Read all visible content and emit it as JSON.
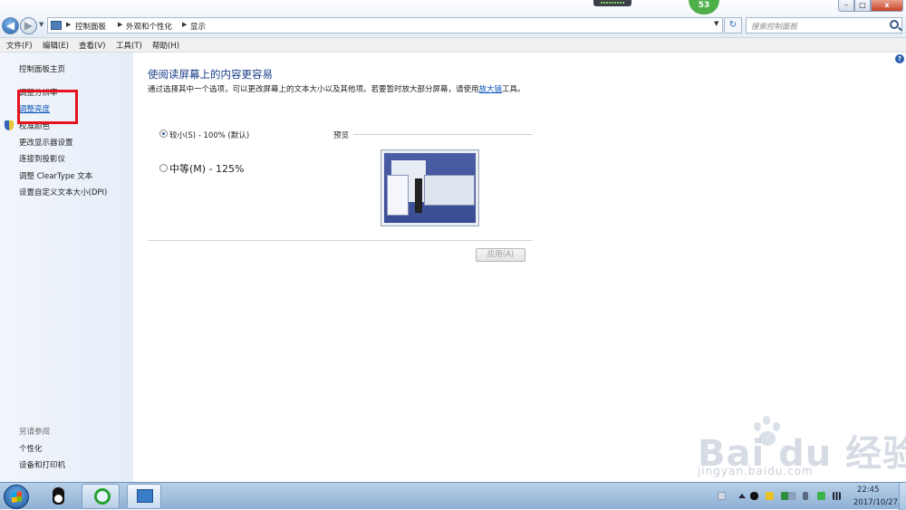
{
  "window": {
    "breadcrumb": [
      "控制面板",
      "外观和个性化",
      "显示"
    ],
    "search_placeholder": "搜索控制面板",
    "min_label": "–",
    "max_label": "□",
    "close_label": "x",
    "badge_count": "53"
  },
  "menu": [
    "文件(F)",
    "编辑(E)",
    "查看(V)",
    "工具(T)",
    "帮助(H)"
  ],
  "sidebar": {
    "items": [
      {
        "label": "控制面板主页"
      },
      {
        "label": "调整分辨率"
      },
      {
        "label": "调整亮度"
      },
      {
        "label": "校准颜色"
      },
      {
        "label": "更改显示器设置"
      },
      {
        "label": "连接到投影仪"
      },
      {
        "label": "调整 ClearType 文本"
      },
      {
        "label": "设置自定义文本大小(DPI)"
      }
    ],
    "see_also_title": "另请参阅",
    "see_also": [
      {
        "label": "个性化"
      },
      {
        "label": "设备和打印机"
      }
    ]
  },
  "main": {
    "title": "使阅读屏幕上的内容更容易",
    "description": "通过选择其中一个选项，可以更改屏幕上的文本大小以及其他项。若要暂时放大部分屏幕，请使用",
    "magnifier_link": "放大镜",
    "description_tail": "工具。",
    "options": [
      {
        "label": "较小(S) - 100% (默认)",
        "selected": true
      },
      {
        "label": "中等(M) - 125%",
        "selected": false
      }
    ],
    "preview_label": "预览",
    "apply_label": "应用(A)",
    "help_label": "?"
  },
  "taskbar": {
    "time": "22:45",
    "date": "2017/10/27"
  },
  "watermark": {
    "logo_text": "Bai du 经验",
    "url": "jingyan.baidu.com"
  },
  "colors": {
    "accent_red_box": "#e6131f",
    "title_blue": "#1a3e8a",
    "link_blue": "#0b52b8"
  }
}
